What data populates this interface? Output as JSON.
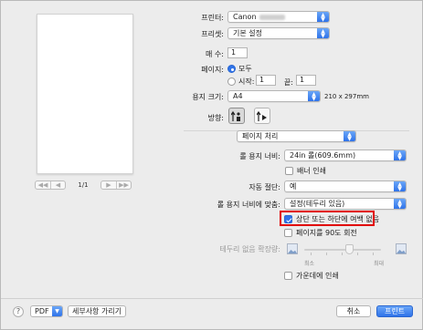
{
  "printer": {
    "label": "프린터:",
    "value": "Canon"
  },
  "presets": {
    "label": "프리셋:",
    "value": "기본 설정"
  },
  "copies": {
    "label": "매 수:",
    "value": "1"
  },
  "pages": {
    "label": "페이지:",
    "all_label": "모두",
    "from_label": "시작:",
    "from_value": "1",
    "to_label": "끝:",
    "to_value": "1"
  },
  "paper_size": {
    "label": "용지 크기:",
    "value": "A4",
    "dimensions": "210 x 297mm"
  },
  "orientation": {
    "label": "방향:"
  },
  "preview": {
    "page_indicator": "1/1",
    "nav_first": "◀◀",
    "nav_prev": "◀",
    "nav_next": "▶",
    "nav_last": "▶▶"
  },
  "section": {
    "value": "페이지 처리"
  },
  "roll_width": {
    "label": "롤 용지 너비:",
    "value": "24in 롤(609.6mm)"
  },
  "banner_print": {
    "label": "배너 인쇄",
    "checked": false
  },
  "auto_cut": {
    "label": "자동 절단:",
    "value": "예"
  },
  "fit_roll": {
    "label": "롤 용지 너비에 맞춤:",
    "value": "설정(테두리 있음)"
  },
  "no_margin": {
    "label": "상단 또는 하단에 여백 없음",
    "checked": true
  },
  "rotate90": {
    "label": "페이지를 90도 회전",
    "checked": false
  },
  "borderless_ext": {
    "label": "테두리 없음 확장량:",
    "min_label": "최소",
    "max_label": "최대"
  },
  "center_print": {
    "label": "가운데에 인쇄",
    "checked": false
  },
  "footer": {
    "help": "?",
    "pdf": "PDF",
    "show_details": "세부사항 가리기",
    "cancel": "취소",
    "print": "프린트"
  },
  "colors": {
    "accent": "#2f73e9",
    "highlight": "#e10000"
  }
}
